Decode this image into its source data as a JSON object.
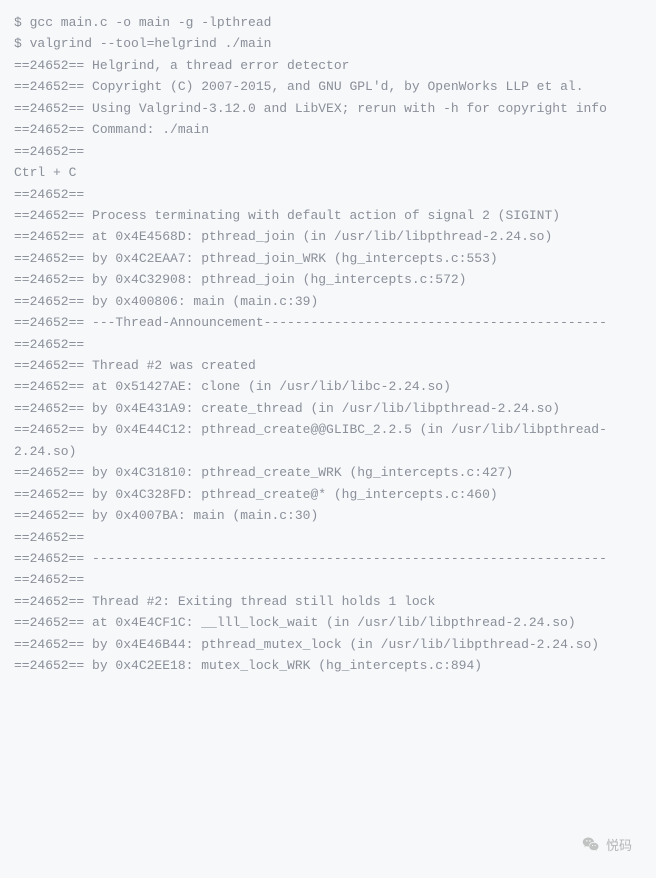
{
  "terminal": {
    "lines": [
      "$ gcc main.c -o main -g -lpthread",
      "$ valgrind --tool=helgrind ./main",
      "==24652== Helgrind, a thread error detector",
      "==24652== Copyright (C) 2007-2015, and GNU GPL'd, by OpenWorks LLP et al.",
      "==24652== Using Valgrind-3.12.0 and LibVEX; rerun with -h for copyright info",
      "==24652== Command: ./main",
      "==24652==",
      "Ctrl + C",
      "==24652==",
      "==24652== Process terminating with default action of signal 2 (SIGINT)",
      "==24652== at 0x4E4568D: pthread_join (in /usr/lib/libpthread-2.24.so)",
      "==24652== by 0x4C2EAA7: pthread_join_WRK (hg_intercepts.c:553)",
      "==24652== by 0x4C32908: pthread_join (hg_intercepts.c:572)",
      "==24652== by 0x400806: main (main.c:39)",
      "==24652== ---Thread-Announcement--------------------------------------------",
      "==24652==",
      "==24652== Thread #2 was created",
      "==24652== at 0x51427AE: clone (in /usr/lib/libc-2.24.so)",
      "==24652== by 0x4E431A9: create_thread (in /usr/lib/libpthread-2.24.so)",
      "==24652== by 0x4E44C12: pthread_create@@GLIBC_2.2.5 (in /usr/lib/libpthread-2.24.so)",
      "==24652== by 0x4C31810: pthread_create_WRK (hg_intercepts.c:427)",
      "==24652== by 0x4C328FD: pthread_create@* (hg_intercepts.c:460)",
      "==24652== by 0x4007BA: main (main.c:30)",
      "==24652==",
      "==24652== ------------------------------------------------------------------",
      "==24652==",
      "==24652== Thread #2: Exiting thread still holds 1 lock",
      "==24652== at 0x4E4CF1C: __lll_lock_wait (in /usr/lib/libpthread-2.24.so)",
      "==24652== by 0x4E46B44: pthread_mutex_lock (in /usr/lib/libpthread-2.24.so)",
      "==24652== by 0x4C2EE18: mutex_lock_WRK (hg_intercepts.c:894)"
    ]
  },
  "watermark": {
    "label": "悦码"
  }
}
